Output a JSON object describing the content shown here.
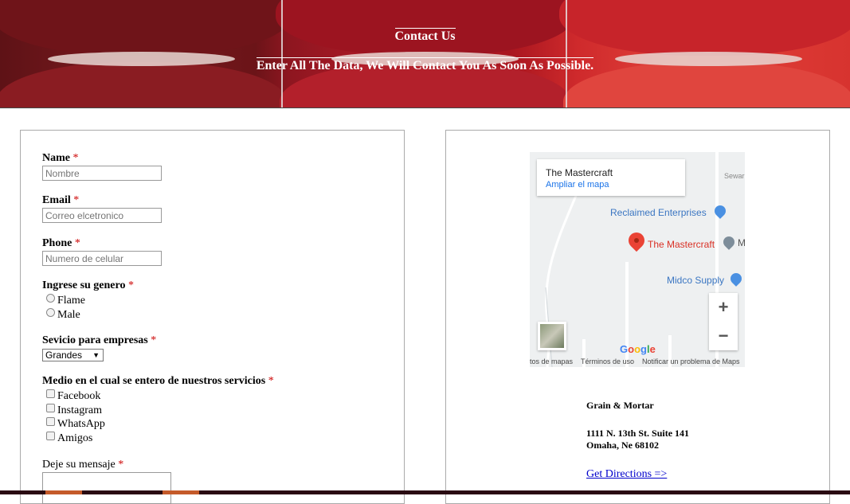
{
  "header": {
    "title": "Contact Us",
    "subtitle": "Enter All The Data, We Will Contact You As Soon As Possible."
  },
  "form": {
    "required_mark": "*",
    "name": {
      "label": "Name",
      "placeholder": "Nombre"
    },
    "email": {
      "label": "Email",
      "placeholder": "Correo elcetronico"
    },
    "phone": {
      "label": "Phone",
      "placeholder": "Numero de celular"
    },
    "gender": {
      "label": "Ingrese su genero",
      "options": [
        "Flame",
        "Male"
      ]
    },
    "service": {
      "label": "Sevicio para empresas",
      "selected": "Grandes"
    },
    "source": {
      "label": "Medio en el cual se entero de nuestros servicios",
      "options": [
        "Facebook",
        "Instagram",
        "WhatsApp",
        "Amigos"
      ]
    },
    "message": {
      "label": "Deje su mensaje"
    }
  },
  "map": {
    "place_name": "The Mastercraft",
    "enlarge_link": "Ampliar el mapa",
    "poi_reclaimed": "Reclaimed Enterprises",
    "poi_mastercraft": "The Mastercraft",
    "poi_midco": "Midco Supply",
    "poi_cut": "M",
    "street_top": "Sewar",
    "google": "Google",
    "footer_data": "tos de mapas",
    "footer_terms": "Términos de uso",
    "footer_report": "Notificar un problema de Maps",
    "zoom_in": "+",
    "zoom_out": "−"
  },
  "location": {
    "business": "Grain & Mortar",
    "address_line1": "1111 N. 13th St. Suite 141",
    "address_line2": "Omaha, Ne 68102",
    "directions": "Get Directions =>"
  }
}
